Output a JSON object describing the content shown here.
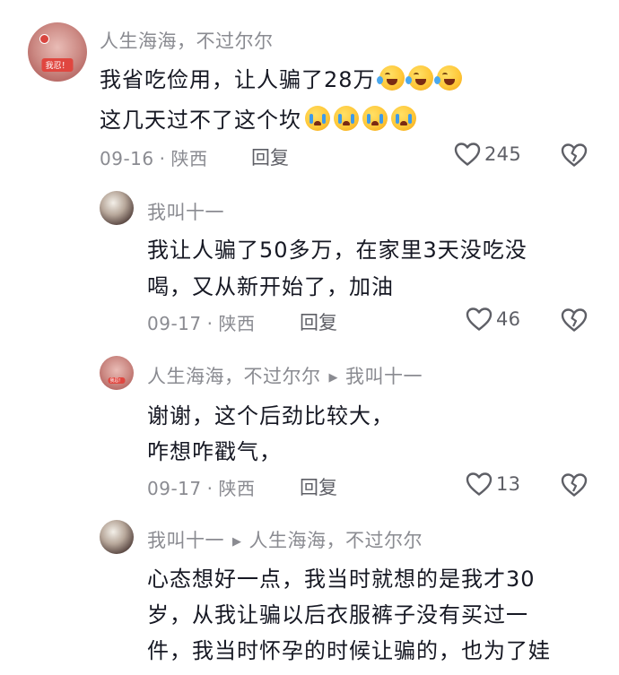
{
  "comments": [
    {
      "username": "人生海海，不过尔尔",
      "avatar_badge": "我忍！",
      "lines": [
        "我省吃俭用，让人骗了28万",
        "这几天过不了这个坎"
      ],
      "date": "09-16",
      "location": "陕西",
      "reply_label": "回复",
      "likes": "245"
    },
    {
      "username": "我叫十一",
      "lines": [
        "我让人骗了50多万，在家里3天没吃没",
        "喝，又从新开始了，加油"
      ],
      "date": "09-17",
      "location": "陕西",
      "reply_label": "回复",
      "likes": "46"
    },
    {
      "username": "人生海海，不过尔尔",
      "reply_to": "我叫十一",
      "avatar_badge": "我忍！",
      "lines": [
        "谢谢，这个后劲比较大，",
        "咋想咋戳气，"
      ],
      "date": "09-17",
      "location": "陕西",
      "reply_label": "回复",
      "likes": "13"
    },
    {
      "username": "我叫十一",
      "reply_to": "人生海海，不过尔尔",
      "lines": [
        "心态想好一点，我当时就想的是我才30",
        "岁，从我让骗以后衣服裤子没有买过一",
        "件，我当时怀孕的时候让骗的，也为了娃"
      ]
    }
  ],
  "icons": {
    "emoji_laugh_cry": "face-with-tears-of-joy-icon",
    "emoji_crying": "loudly-crying-face-icon",
    "like": "heart-outline-icon",
    "dislike": "broken-heart-icon",
    "reply_arrow": "triangle-right-icon"
  },
  "colors": {
    "text": "#161823",
    "secondary": "#8a8b91",
    "action": "#5e5f66"
  }
}
